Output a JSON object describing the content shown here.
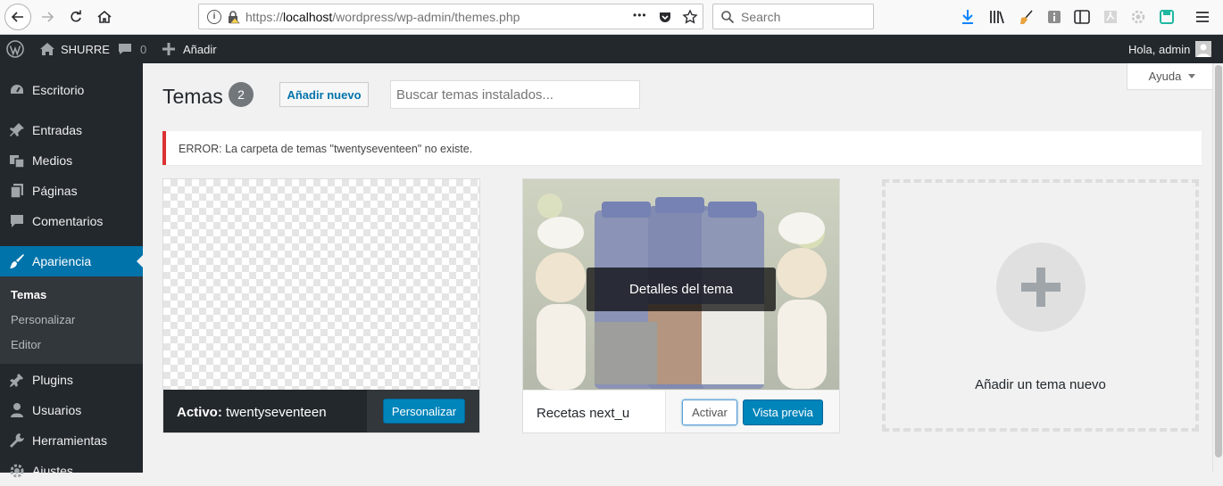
{
  "browser": {
    "url_prefix": "https://",
    "url_host": "localhost",
    "url_path": "/wordpress/wp-admin/themes.php",
    "search_placeholder": "Search",
    "more_dots": "•••"
  },
  "adminbar": {
    "site_name": "SHURRE",
    "comments_count": "0",
    "add_new": "Añadir",
    "greeting": "Hola, admin"
  },
  "sidebar": {
    "items": [
      {
        "label": "Escritorio",
        "icon": "dashboard-icon"
      },
      {
        "label": "Entradas",
        "icon": "pin-icon"
      },
      {
        "label": "Medios",
        "icon": "media-icon"
      },
      {
        "label": "Páginas",
        "icon": "pages-icon"
      },
      {
        "label": "Comentarios",
        "icon": "comments-icon"
      },
      {
        "label": "Apariencia",
        "icon": "appearance-icon"
      },
      {
        "label": "Plugins",
        "icon": "plugins-icon"
      },
      {
        "label": "Usuarios",
        "icon": "users-icon"
      },
      {
        "label": "Herramientas",
        "icon": "tools-icon"
      },
      {
        "label": "Ajustes",
        "icon": "settings-icon"
      }
    ],
    "submenu": [
      "Temas",
      "Personalizar",
      "Editor"
    ]
  },
  "main": {
    "title": "Temas",
    "count": "2",
    "add_new_button": "Añadir nuevo",
    "search_placeholder": "Buscar temas instalados...",
    "help_button": "Ayuda",
    "error_message": "ERROR: La carpeta de temas \"twentyseventeen\" no existe.",
    "themes": {
      "active_prefix": "Activo:",
      "active_name": "twentyseventeen",
      "customize_button": "Personalizar",
      "theme2_name": "Recetas next_u",
      "theme_details": "Detalles del tema",
      "activate_button": "Activar",
      "preview_button": "Vista previa",
      "add_theme_label": "Añadir un tema nuevo"
    }
  },
  "colors": {
    "accent": "#0073aa",
    "adminbar": "#23282d",
    "error": "#dc3232"
  }
}
